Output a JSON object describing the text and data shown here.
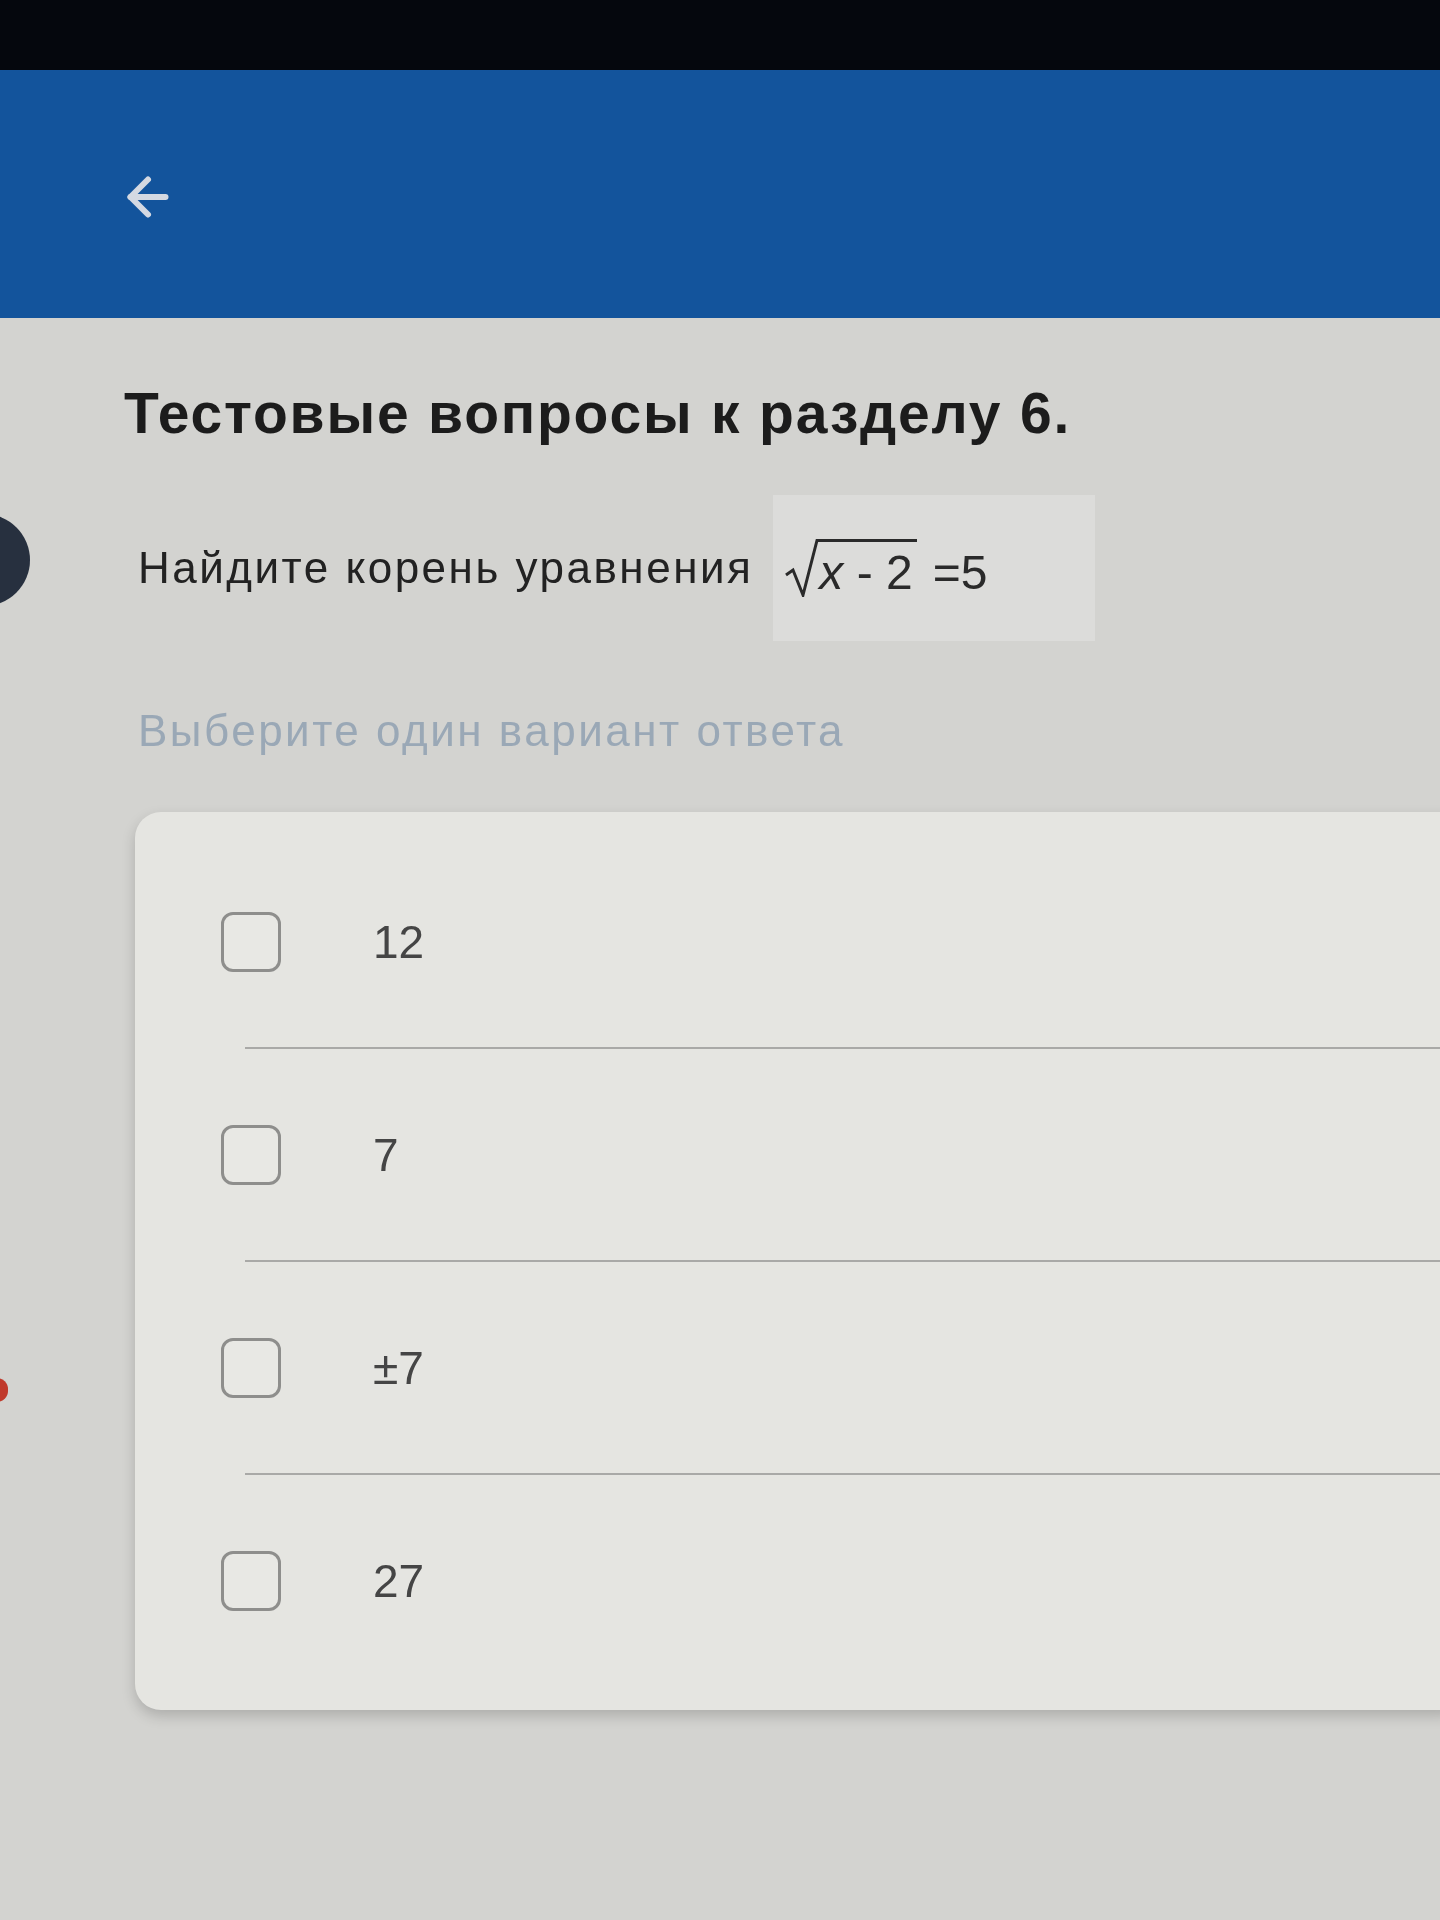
{
  "title": "Тестовые вопросы к разделу 6.",
  "question": {
    "text": "Найдите корень уравнения",
    "formula": {
      "radicand": "*x* - 2",
      "rest": "=5"
    }
  },
  "instruction": "Выберите один вариант ответа",
  "options": [
    {
      "label": "12",
      "checked": false
    },
    {
      "label": "7",
      "checked": false
    },
    {
      "label": "±7",
      "checked": false
    },
    {
      "label": "27",
      "checked": false
    }
  ]
}
